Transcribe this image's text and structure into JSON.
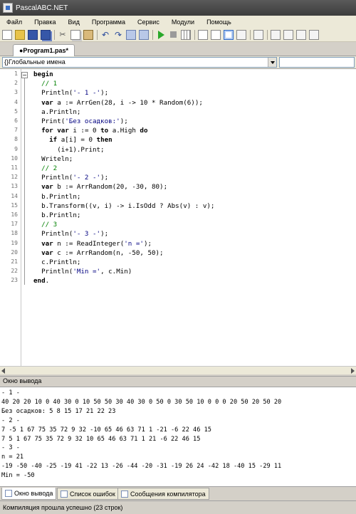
{
  "window": {
    "title": "PascalABC.NET"
  },
  "menu": [
    "Файл",
    "Правка",
    "Вид",
    "Программа",
    "Сервис",
    "Модули",
    "Помощь"
  ],
  "editor_tab": {
    "label": "●Program1.pas*"
  },
  "scope": {
    "selected": "{}Глобальные имена"
  },
  "code": {
    "line_numbers": [
      "1",
      "2",
      "3",
      "4",
      "5",
      "6",
      "7",
      "8",
      "9",
      "10",
      "11",
      "12",
      "13",
      "14",
      "15",
      "16",
      "17",
      "18",
      "19",
      "20",
      "21",
      "22",
      "23"
    ],
    "lines": [
      [
        {
          "t": "begin",
          "c": "kw"
        }
      ],
      [
        {
          "t": "  // 1",
          "c": "cm"
        }
      ],
      [
        {
          "t": "  Println(",
          "c": ""
        },
        {
          "t": "'- 1 -'",
          "c": "st"
        },
        {
          "t": ");",
          "c": ""
        }
      ],
      [
        {
          "t": "  ",
          "c": ""
        },
        {
          "t": "var",
          "c": "kw"
        },
        {
          "t": " a := ArrGen(28, i -> 10 * Random(6));",
          "c": ""
        }
      ],
      [
        {
          "t": "  a.Println;",
          "c": ""
        }
      ],
      [
        {
          "t": "  Print(",
          "c": ""
        },
        {
          "t": "'Без осадков:'",
          "c": "st"
        },
        {
          "t": ");",
          "c": ""
        }
      ],
      [
        {
          "t": "  ",
          "c": ""
        },
        {
          "t": "for var",
          "c": "kw"
        },
        {
          "t": " i := 0 ",
          "c": ""
        },
        {
          "t": "to",
          "c": "kw"
        },
        {
          "t": " a.High ",
          "c": ""
        },
        {
          "t": "do",
          "c": "kw"
        }
      ],
      [
        {
          "t": "    ",
          "c": ""
        },
        {
          "t": "if",
          "c": "kw"
        },
        {
          "t": " a[i] = 0 ",
          "c": ""
        },
        {
          "t": "then",
          "c": "kw"
        }
      ],
      [
        {
          "t": "      (i+1).Print;",
          "c": ""
        }
      ],
      [
        {
          "t": "  Writeln;",
          "c": ""
        }
      ],
      [
        {
          "t": "  // 2",
          "c": "cm"
        }
      ],
      [
        {
          "t": "  Println(",
          "c": ""
        },
        {
          "t": "'- 2 -'",
          "c": "st"
        },
        {
          "t": ");",
          "c": ""
        }
      ],
      [
        {
          "t": "  ",
          "c": ""
        },
        {
          "t": "var",
          "c": "kw"
        },
        {
          "t": " b := ArrRandom(20, -30, 80);",
          "c": ""
        }
      ],
      [
        {
          "t": "  b.Println;",
          "c": ""
        }
      ],
      [
        {
          "t": "  b.Transform((v, i) -> i.IsOdd ? Abs(v) : v);",
          "c": ""
        }
      ],
      [
        {
          "t": "  b.Println;",
          "c": ""
        }
      ],
      [
        {
          "t": "  // 3",
          "c": "cm"
        }
      ],
      [
        {
          "t": "  Println(",
          "c": ""
        },
        {
          "t": "'- 3 -'",
          "c": "st"
        },
        {
          "t": ");",
          "c": ""
        }
      ],
      [
        {
          "t": "  ",
          "c": ""
        },
        {
          "t": "var",
          "c": "kw"
        },
        {
          "t": " n := ReadInteger(",
          "c": ""
        },
        {
          "t": "'n ='",
          "c": "st"
        },
        {
          "t": ");",
          "c": ""
        }
      ],
      [
        {
          "t": "  ",
          "c": ""
        },
        {
          "t": "var",
          "c": "kw"
        },
        {
          "t": " c := ArrRandom(n, -50, 50);",
          "c": ""
        }
      ],
      [
        {
          "t": "  c.Println;",
          "c": ""
        }
      ],
      [
        {
          "t": "  Println(",
          "c": ""
        },
        {
          "t": "'Min ='",
          "c": "st"
        },
        {
          "t": ", c.Min)",
          "c": ""
        }
      ],
      [
        {
          "t": "end",
          "c": "kw"
        },
        {
          "t": ".",
          "c": ""
        }
      ]
    ]
  },
  "output_panel": {
    "header": "Окно вывода",
    "lines": [
      "- 1 -",
      "40 20 20 10 0 40 30 0 10 50 50 30 40 30 0 50 0 30 50 10 0 0 0 20 50 20 50 20",
      "Без осадков: 5 8 15 17 21 22 23",
      "- 2 -",
      "7 -5 1 67 75 35 72 9 32 -10 65 46 63 71 1 -21 -6 22 46 15",
      "7 5 1 67 75 35 72 9 32 10 65 46 63 71 1 21 -6 22 46 15",
      "- 3 -",
      "n = 21",
      "-19 -50 -40 -25 -19 41 -22 13 -26 -44 -20 -31 -19 26 24 -42 18 -40 15 -29 11",
      "Min = -50"
    ]
  },
  "bottom_tabs": [
    "Окно вывода",
    "Список ошибок",
    "Сообщения компилятора"
  ],
  "status": {
    "text": "Компиляция прошла успешно (23 строк)"
  }
}
